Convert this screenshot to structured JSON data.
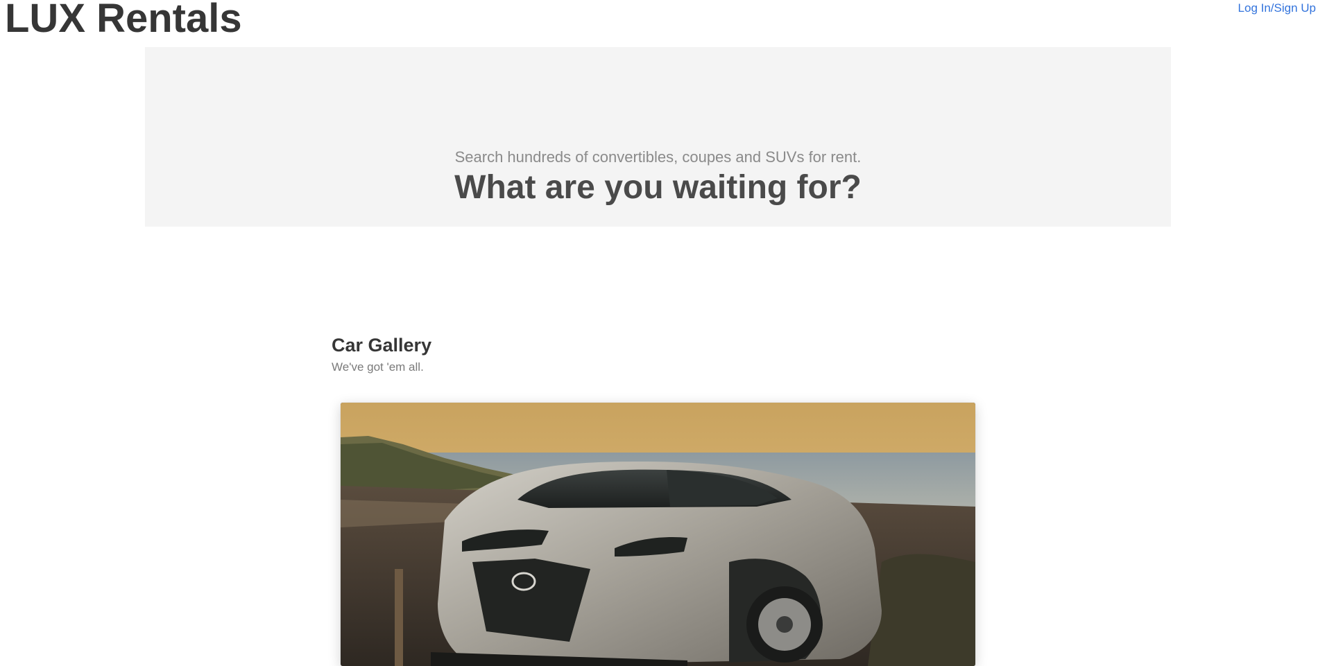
{
  "header": {
    "site_title": "LUX Rentals",
    "auth_link": "Log In/Sign Up"
  },
  "hero": {
    "subtitle": "Search hundreds of convertibles, coupes and SUVs for rent.",
    "title": "What are you waiting for?"
  },
  "gallery": {
    "title": "Car Gallery",
    "subtitle": "We've got 'em all.",
    "images": [
      {
        "alt": "Silver Lexus SUV parked by the ocean at sunset"
      }
    ]
  },
  "colors": {
    "link": "#3273dc",
    "hero_background": "#f4f4f4",
    "title_text": "#363636",
    "muted_text": "#8a8a8a"
  }
}
